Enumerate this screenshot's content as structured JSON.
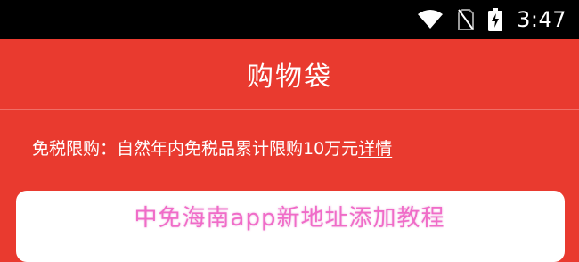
{
  "status_bar": {
    "time": "3:47",
    "icons": [
      "wifi-icon",
      "no-sim-icon",
      "battery-charging-icon"
    ]
  },
  "header": {
    "title": "购物袋"
  },
  "notice": {
    "text": "免税限购：自然年内免税品累计限购10万元",
    "link_label": "详情"
  },
  "watermark": {
    "text": "中免海南app新地址添加教程"
  },
  "colors": {
    "header_background": "#e93a2f",
    "status_bar_background": "#000000",
    "text": "#ffffff",
    "watermark": "#f06cc8"
  }
}
